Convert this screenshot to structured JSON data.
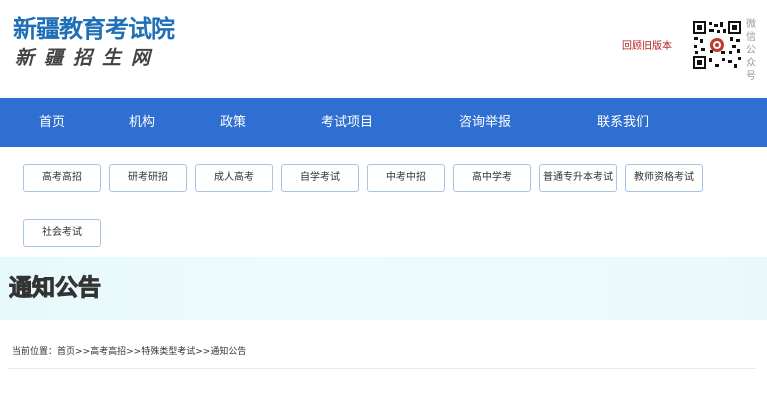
{
  "header": {
    "logo_title": "新疆教育考试院",
    "logo_subtitle": "新疆招生网",
    "old_version_link": "回顾旧版本",
    "qr_label": "微信公众号"
  },
  "nav": {
    "items": [
      "首页",
      "机构",
      "政策",
      "考试项目",
      "咨询举报",
      "联系我们"
    ]
  },
  "categories": [
    "高考高招",
    "研考研招",
    "成人高考",
    "自学考试",
    "中考中招",
    "高中学考",
    "普通专升本考试",
    "教师资格考试",
    "社会考试"
  ],
  "banner": {
    "title": "通知公告"
  },
  "breadcrumb": {
    "prefix": "当前位置：",
    "items": [
      "首页",
      "高考高招",
      "特殊类型考试",
      "通知公告"
    ],
    "separator": ">>"
  },
  "colors": {
    "nav_bg": "#2f6fd1",
    "logo_blue": "#1f6fb8",
    "old_link_red": "#b22222",
    "banner_bg": "#e9f9fb"
  }
}
